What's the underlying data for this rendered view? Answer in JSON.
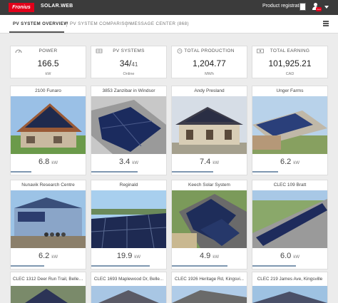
{
  "header": {
    "logo_text": "Fronius",
    "app_name": "SOLAR.WEB",
    "product_registration": "Product registration",
    "user_badge": "neu"
  },
  "nav": {
    "tabs": [
      {
        "label": "PV SYSTEM OVERVIEW",
        "active": true
      },
      {
        "label": "PV SYSTEM COMPARISON",
        "active": false
      },
      {
        "label": "MESSAGE CENTER (868)",
        "active": false
      }
    ]
  },
  "stats": [
    {
      "label": "POWER",
      "value": "166.5",
      "unit": "kW",
      "icon": "power-meter-icon"
    },
    {
      "label": "PV SYSTEMS",
      "value": "34/",
      "total": "41",
      "unit": "Online",
      "icon": "solar-panel-icon"
    },
    {
      "label": "TOTAL PRODUCTION",
      "value": "1,204.77",
      "unit": "MWh",
      "icon": "clock-icon"
    },
    {
      "label": "TOTAL EARNING",
      "value": "101,925.21",
      "unit": "CAD",
      "icon": "banknote-icon"
    }
  ],
  "systems": [
    {
      "name": "2100 Funaro",
      "power": "6.8",
      "unit": "kW",
      "fill": 0.28
    },
    {
      "name": "3853 Zanzibar in Windsor",
      "power": "3.4",
      "unit": "kW",
      "fill": 0.62
    },
    {
      "name": "Andy Presland",
      "power": "7.4",
      "unit": "kW",
      "fill": 0.55
    },
    {
      "name": "Unger Farms",
      "power": "6.2",
      "unit": "kW",
      "fill": 0.34
    },
    {
      "name": "Nunavik Research Centre",
      "power": "6.2",
      "unit": "kW",
      "fill": 0.45
    },
    {
      "name": "Reginald",
      "power": "19.9",
      "unit": "kW",
      "fill": 0.78
    },
    {
      "name": "Keech Solar System",
      "power": "4.9",
      "unit": "kW",
      "fill": 0.74
    },
    {
      "name": "CLEC 109 Bratt",
      "power": "6.0",
      "unit": "kW",
      "fill": 0.58
    }
  ],
  "bottom_systems": [
    {
      "name": "CLEC 1312 Deer Run Trail, Belle ..."
    },
    {
      "name": "CLEC 1693 Maplewood Dr, Belle..."
    },
    {
      "name": "CLEC 1926 Heritage Rd, Kingsvi..."
    },
    {
      "name": "CLEC 219 James Ave, Kingsville"
    }
  ],
  "colors": {
    "topbar": "#3b3b3b",
    "brand": "#e2001a",
    "progress": "#7e97b0"
  }
}
